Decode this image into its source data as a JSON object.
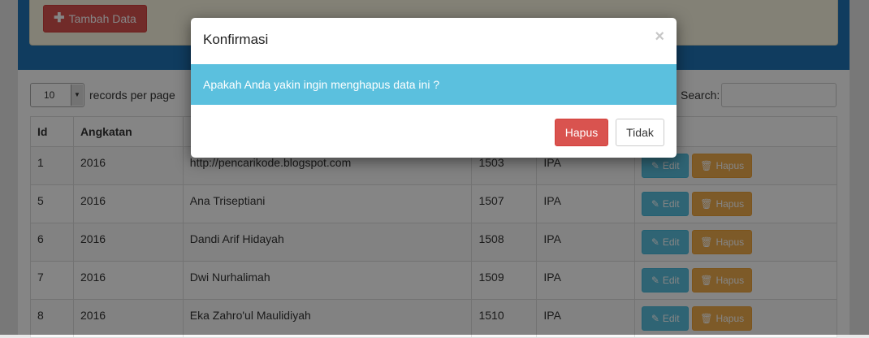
{
  "toolbar": {
    "add_label": "Tambah Data",
    "add_icon": "plus-icon"
  },
  "length_control": {
    "value": "10",
    "label": "records per page"
  },
  "search": {
    "label": "Search:",
    "value": ""
  },
  "table": {
    "columns": [
      "Id",
      "Angkatan",
      "",
      "",
      "",
      ""
    ],
    "rows": [
      {
        "id": "1",
        "angkatan": "2016",
        "name": "http://pencarikode.blogspot.com",
        "nis": "1503",
        "jurusan": "IPA"
      },
      {
        "id": "5",
        "angkatan": "2016",
        "name": "Ana Triseptiani",
        "nis": "1507",
        "jurusan": "IPA"
      },
      {
        "id": "6",
        "angkatan": "2016",
        "name": "Dandi Arif Hidayah",
        "nis": "1508",
        "jurusan": "IPA"
      },
      {
        "id": "7",
        "angkatan": "2016",
        "name": "Dwi Nurhalimah",
        "nis": "1509",
        "jurusan": "IPA"
      },
      {
        "id": "8",
        "angkatan": "2016",
        "name": "Eka Zahro'ul Maulidiyah",
        "nis": "1510",
        "jurusan": "IPA"
      }
    ],
    "edit_label": "Edit",
    "delete_label": "Hapus"
  },
  "modal": {
    "title": "Konfirmasi",
    "close_symbol": "×",
    "message": "Apakah Anda yakin ingin menghapus data ini ?",
    "confirm_label": "Hapus",
    "cancel_label": "Tidak"
  },
  "colors": {
    "primary_frame": "#1f73b7",
    "danger": "#d9534f",
    "info": "#5bc0de",
    "warning": "#f0ad4e"
  }
}
